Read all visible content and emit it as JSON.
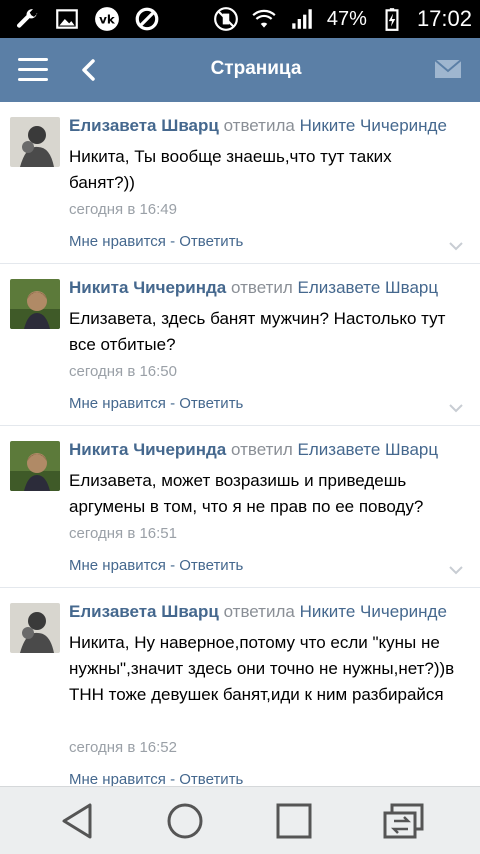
{
  "statusbar": {
    "battery": "47%",
    "time": "17:02",
    "icons": [
      "wrench-icon",
      "image-icon",
      "vk-icon",
      "blocked-icon",
      "mute-icon",
      "wifi-icon",
      "signal-icon",
      "battery-charging-icon"
    ]
  },
  "header": {
    "title": "Страница",
    "icons": [
      "menu-icon",
      "back-icon",
      "mail-icon"
    ]
  },
  "comments": [
    {
      "author": "Елизавета Шварц",
      "verb": "ответила",
      "target": "Никите Чичеринде",
      "text": "Никита, Ты вообще знаешь,что тут таких банят?))",
      "date": "сегодня в 16:49",
      "actions": "Мне нравится - Ответить"
    },
    {
      "author": "Никита Чичеринда",
      "verb": "ответил",
      "target": "Елизавете Шварц",
      "text": "Елизавета, здесь банят мужчин? Настолько тут все отбитые?",
      "date": "сегодня в 16:50",
      "actions": "Мне нравится - Ответить"
    },
    {
      "author": "Никита Чичеринда",
      "verb": "ответил",
      "target": "Елизавете Шварц",
      "text": "Елизавета, может возразишь и приведешь аргумены в том, что я не прав по ее поводу?",
      "date": "сегодня в 16:51",
      "actions": "Мне нравится - Ответить"
    },
    {
      "author": "Елизавета Шварц",
      "verb": "ответила",
      "target": "Никите Чичеринде",
      "text": "Никита, Ну наверное,потому что если \"куны не нужны\",значит здесь они точно не нужны,нет?))в ТНН тоже девушек банят,иди к ним разбирайся",
      "date": "сегодня в 16:52",
      "actions": "Мне нравится - Ответить"
    }
  ],
  "navbar": {
    "icons": [
      "back-triangle-icon",
      "home-circle-icon",
      "recents-square-icon",
      "switch-app-icon"
    ]
  }
}
